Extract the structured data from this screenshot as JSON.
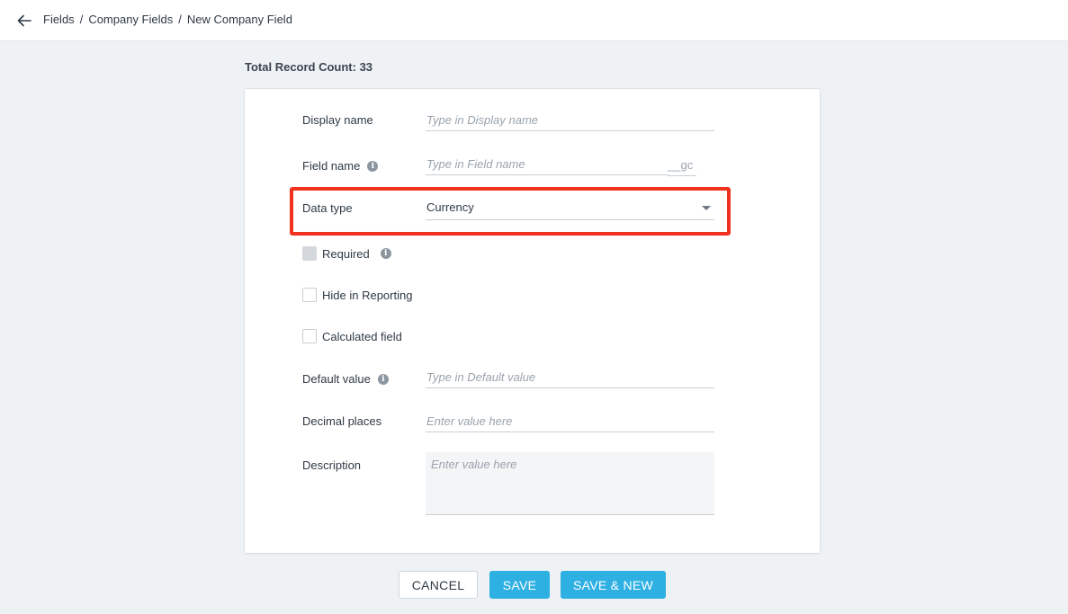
{
  "breadcrumb": {
    "back_icon": "arrow-left-icon",
    "items": [
      "Fields",
      "Company Fields",
      "New Company Field"
    ],
    "separator": "/"
  },
  "record_count": "Total Record Count: 33",
  "form": {
    "display_name": {
      "label": "Display name",
      "placeholder": "Type in Display name"
    },
    "field_name": {
      "label": "Field name",
      "placeholder": "Type in Field name",
      "suffix": "__gc"
    },
    "data_type": {
      "label": "Data type",
      "value": "Currency"
    },
    "required": {
      "label": "Required",
      "checked": false,
      "disabled": true
    },
    "hide_in_reporting": {
      "label": "Hide in Reporting",
      "checked": false
    },
    "calculated_field": {
      "label": "Calculated field",
      "checked": false
    },
    "default_value": {
      "label": "Default value",
      "placeholder": "Type in Default value"
    },
    "decimal_places": {
      "label": "Decimal places",
      "placeholder": "Enter value here"
    },
    "description": {
      "label": "Description",
      "placeholder": "Enter value here"
    }
  },
  "buttons": {
    "cancel": "CANCEL",
    "save": "SAVE",
    "save_new": "SAVE & NEW"
  },
  "colors": {
    "accent": "#2eb0e3",
    "highlight": "#f0321e",
    "background": "#eff2f5"
  }
}
